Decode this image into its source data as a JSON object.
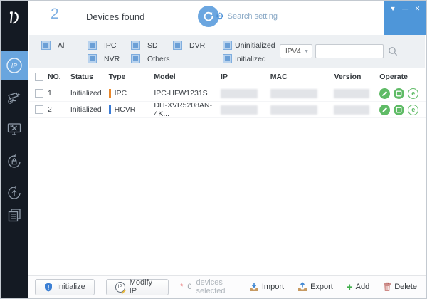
{
  "app": {
    "device_count": "2",
    "devices_found_label": "Devices found",
    "search_setting_label": "Search setting"
  },
  "titlebar": {
    "menu_icon": "▼",
    "minimize_icon": "—",
    "close_icon": "✕",
    "accent_color": "#4e96d9"
  },
  "sidebar": {
    "logo_icon": "configtool-logo",
    "items": [
      {
        "name": "modify-ip",
        "icon": "ip-circle-icon",
        "active": true
      },
      {
        "name": "device-config",
        "icon": "camera-gear-icon",
        "active": false
      },
      {
        "name": "system-settings",
        "icon": "monitor-tools-icon",
        "active": false
      },
      {
        "name": "password-reset",
        "icon": "lock-refresh-icon",
        "active": false
      },
      {
        "name": "device-upgrade",
        "icon": "arrow-up-circle-icon",
        "active": false
      },
      {
        "name": "build-config",
        "icon": "documents-icon",
        "active": false
      }
    ]
  },
  "filters": {
    "all": "All",
    "ipc": "IPC",
    "nvr": "NVR",
    "sd": "SD",
    "others": "Others",
    "dvr": "DVR",
    "uninitialized": "Uninitialized",
    "initialized": "Initialized",
    "all_checked": true
  },
  "search": {
    "protocol_selected": "IPV4",
    "query_value": "",
    "query_placeholder": "",
    "magnifier_icon": "search-icon"
  },
  "table": {
    "select_all_checked": false,
    "headers": {
      "no": "NO.",
      "status": "Status",
      "type": "Type",
      "model": "Model",
      "ip": "IP",
      "mac": "MAC",
      "version": "Version",
      "operate": "Operate"
    },
    "operate_icons": [
      "edit-pencil-icon",
      "device-details-icon",
      "open-web-e-icon"
    ],
    "rows": [
      {
        "no": "1",
        "status": "Initialized",
        "type": "IPC",
        "type_color": "#e8872b",
        "model": "IPC-HFW1231S",
        "ip_redacted": true,
        "mac_redacted": true,
        "version_redacted": true,
        "checked": false
      },
      {
        "no": "2",
        "status": "Initialized",
        "type": "HCVR",
        "type_color": "#3a7bd5",
        "model": "DH-XVR5208AN-4K...",
        "ip_redacted": true,
        "mac_redacted": true,
        "version_redacted": true,
        "checked": false
      }
    ]
  },
  "footer": {
    "initialize_label": "Initialize",
    "modify_ip_label": "Modify IP",
    "selected_marker": "*",
    "selected_count": "0",
    "selected_label": "devices selected",
    "import_label": "Import",
    "export_label": "Export",
    "add_label": "Add",
    "delete_label": "Delete"
  },
  "colors": {
    "accent_blue": "#4e96d9",
    "light_blue": "#6ba6e0",
    "operate_green": "#5fbb66",
    "sidebar_dark": "#141a23"
  }
}
